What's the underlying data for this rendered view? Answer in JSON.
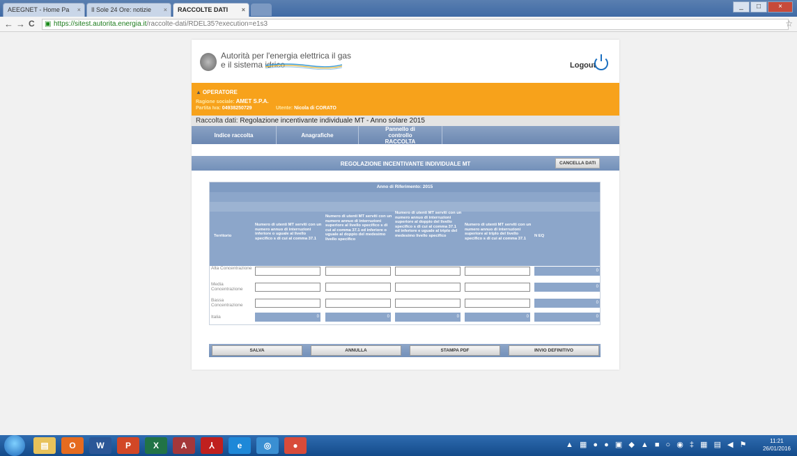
{
  "browser": {
    "tabs": [
      {
        "label": "AEEGNET - Home Pa"
      },
      {
        "label": "Il Sole 24 Ore: notizie"
      },
      {
        "label": "RACCOLTE DATI",
        "active": true
      }
    ],
    "tab_close": "×",
    "back": "←",
    "forward": "→",
    "reload": "C",
    "url_scheme": "https://",
    "url_host": "sitest.autorita.energia.it",
    "url_path": "/raccolte-dati/RDEL35?execution=e1s3",
    "bookmark_star": "☆"
  },
  "header": {
    "logo_line1": "Autorità per l'energia elettrica il gas",
    "logo_line2": "e il sistema idrico",
    "logout_label": "Logout"
  },
  "operator": {
    "title": "OPERATORE",
    "ragione_label": "Ragione sociale:",
    "ragione_value": "AMET S.P.A.",
    "piva_label": "Partita Iva:",
    "piva_value": "04938250729",
    "utente_label": "Utente:",
    "utente_value": "Nicola di CORATO"
  },
  "raccolta": {
    "label": "Raccolta dati:",
    "value": "Regolazione incentivante individuale MT - Anno solare 2015"
  },
  "menu": {
    "items": [
      {
        "label": "Indice raccolta"
      },
      {
        "label": "Anagrafiche"
      },
      {
        "label": "Pannello di controllo RACCOLTA"
      }
    ]
  },
  "section": {
    "title": "REGOLAZIONE INCENTIVANTE INDIVIDUALE MT",
    "cancel_label": "CANCELLA DATI"
  },
  "table": {
    "anno": "Anno di Riferimento: 2015",
    "headers": {
      "territorio": "Territorio",
      "col1": "Numero di utenti MT serviti con un numero annuo di interruzioni inferiore o uguale al livello specifico s di cui al comma 37.1",
      "col2": "Numero di utenti MT serviti con un numero annuo di interruzioni superiore al livello specifico s di cui al comma 37.1 ed inferiore o uguale al doppio del medesimo livello specifico",
      "col3": "Numero di utenti MT serviti con un numero annuo di interruzioni superiore al doppio del livello specifico s di cui al comma 37.1 ed inferiore e uguale al triplo del medesimo livello specifico",
      "col4": "Numero di utenti MT serviti con un numero annuo di interruzioni superiore al triplo del livello specifico s di cui al comma 37.1",
      "neq": "N EQ"
    },
    "rows": [
      {
        "label": "Alta Concentrazione",
        "neq": "0"
      },
      {
        "label": "Media Concentrazione",
        "neq": "0"
      },
      {
        "label": "Bassa Concentrazione",
        "neq": "0"
      }
    ],
    "totals": {
      "label": "Italia",
      "c1": "0",
      "c2": "0",
      "c3": "0",
      "c4": "0",
      "neq": "0"
    }
  },
  "buttons": {
    "salva": "SALVA",
    "annulla": "ANNULLA",
    "stampa": "STAMPA PDF",
    "invio": "INVIO DEFINITIVO"
  },
  "taskbar": {
    "apps": [
      {
        "name": "explorer-icon",
        "glyph": "▤",
        "color": "#e8c25a"
      },
      {
        "name": "outlook-icon",
        "glyph": "O",
        "color": "#e56b1f"
      },
      {
        "name": "word-icon",
        "glyph": "W",
        "color": "#2b5797"
      },
      {
        "name": "powerpoint-icon",
        "glyph": "P",
        "color": "#d24726"
      },
      {
        "name": "excel-icon",
        "glyph": "X",
        "color": "#217346"
      },
      {
        "name": "access-icon",
        "glyph": "A",
        "color": "#a4373a"
      },
      {
        "name": "acrobat-icon",
        "glyph": "⅄",
        "color": "#c0201e"
      },
      {
        "name": "ie-icon",
        "glyph": "e",
        "color": "#1e88d8"
      },
      {
        "name": "app-icon",
        "glyph": "◎",
        "color": "#3a8fd2"
      },
      {
        "name": "chrome-icon",
        "glyph": "●",
        "color": "#d84b3a"
      }
    ],
    "time": "11:21",
    "date": "26/01/2016"
  }
}
